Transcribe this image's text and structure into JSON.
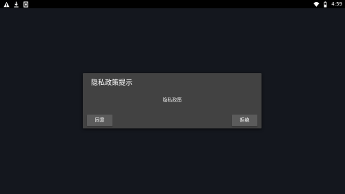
{
  "status_bar": {
    "time": "4:59",
    "left_icons": [
      "warning-icon",
      "download-icon",
      "sd-card-icon"
    ],
    "right_icons": [
      "wifi-icon",
      "battery-icon"
    ]
  },
  "dialog": {
    "title": "隐私政策提示",
    "message": "隐私政策",
    "agree_label": "同意",
    "refuse_label": "拒绝"
  },
  "colors": {
    "background": "#14171e",
    "status_bar": "#000000",
    "dialog_bg": "#424242",
    "button_bg": "#5b5b5b",
    "text": "#ffffff"
  }
}
